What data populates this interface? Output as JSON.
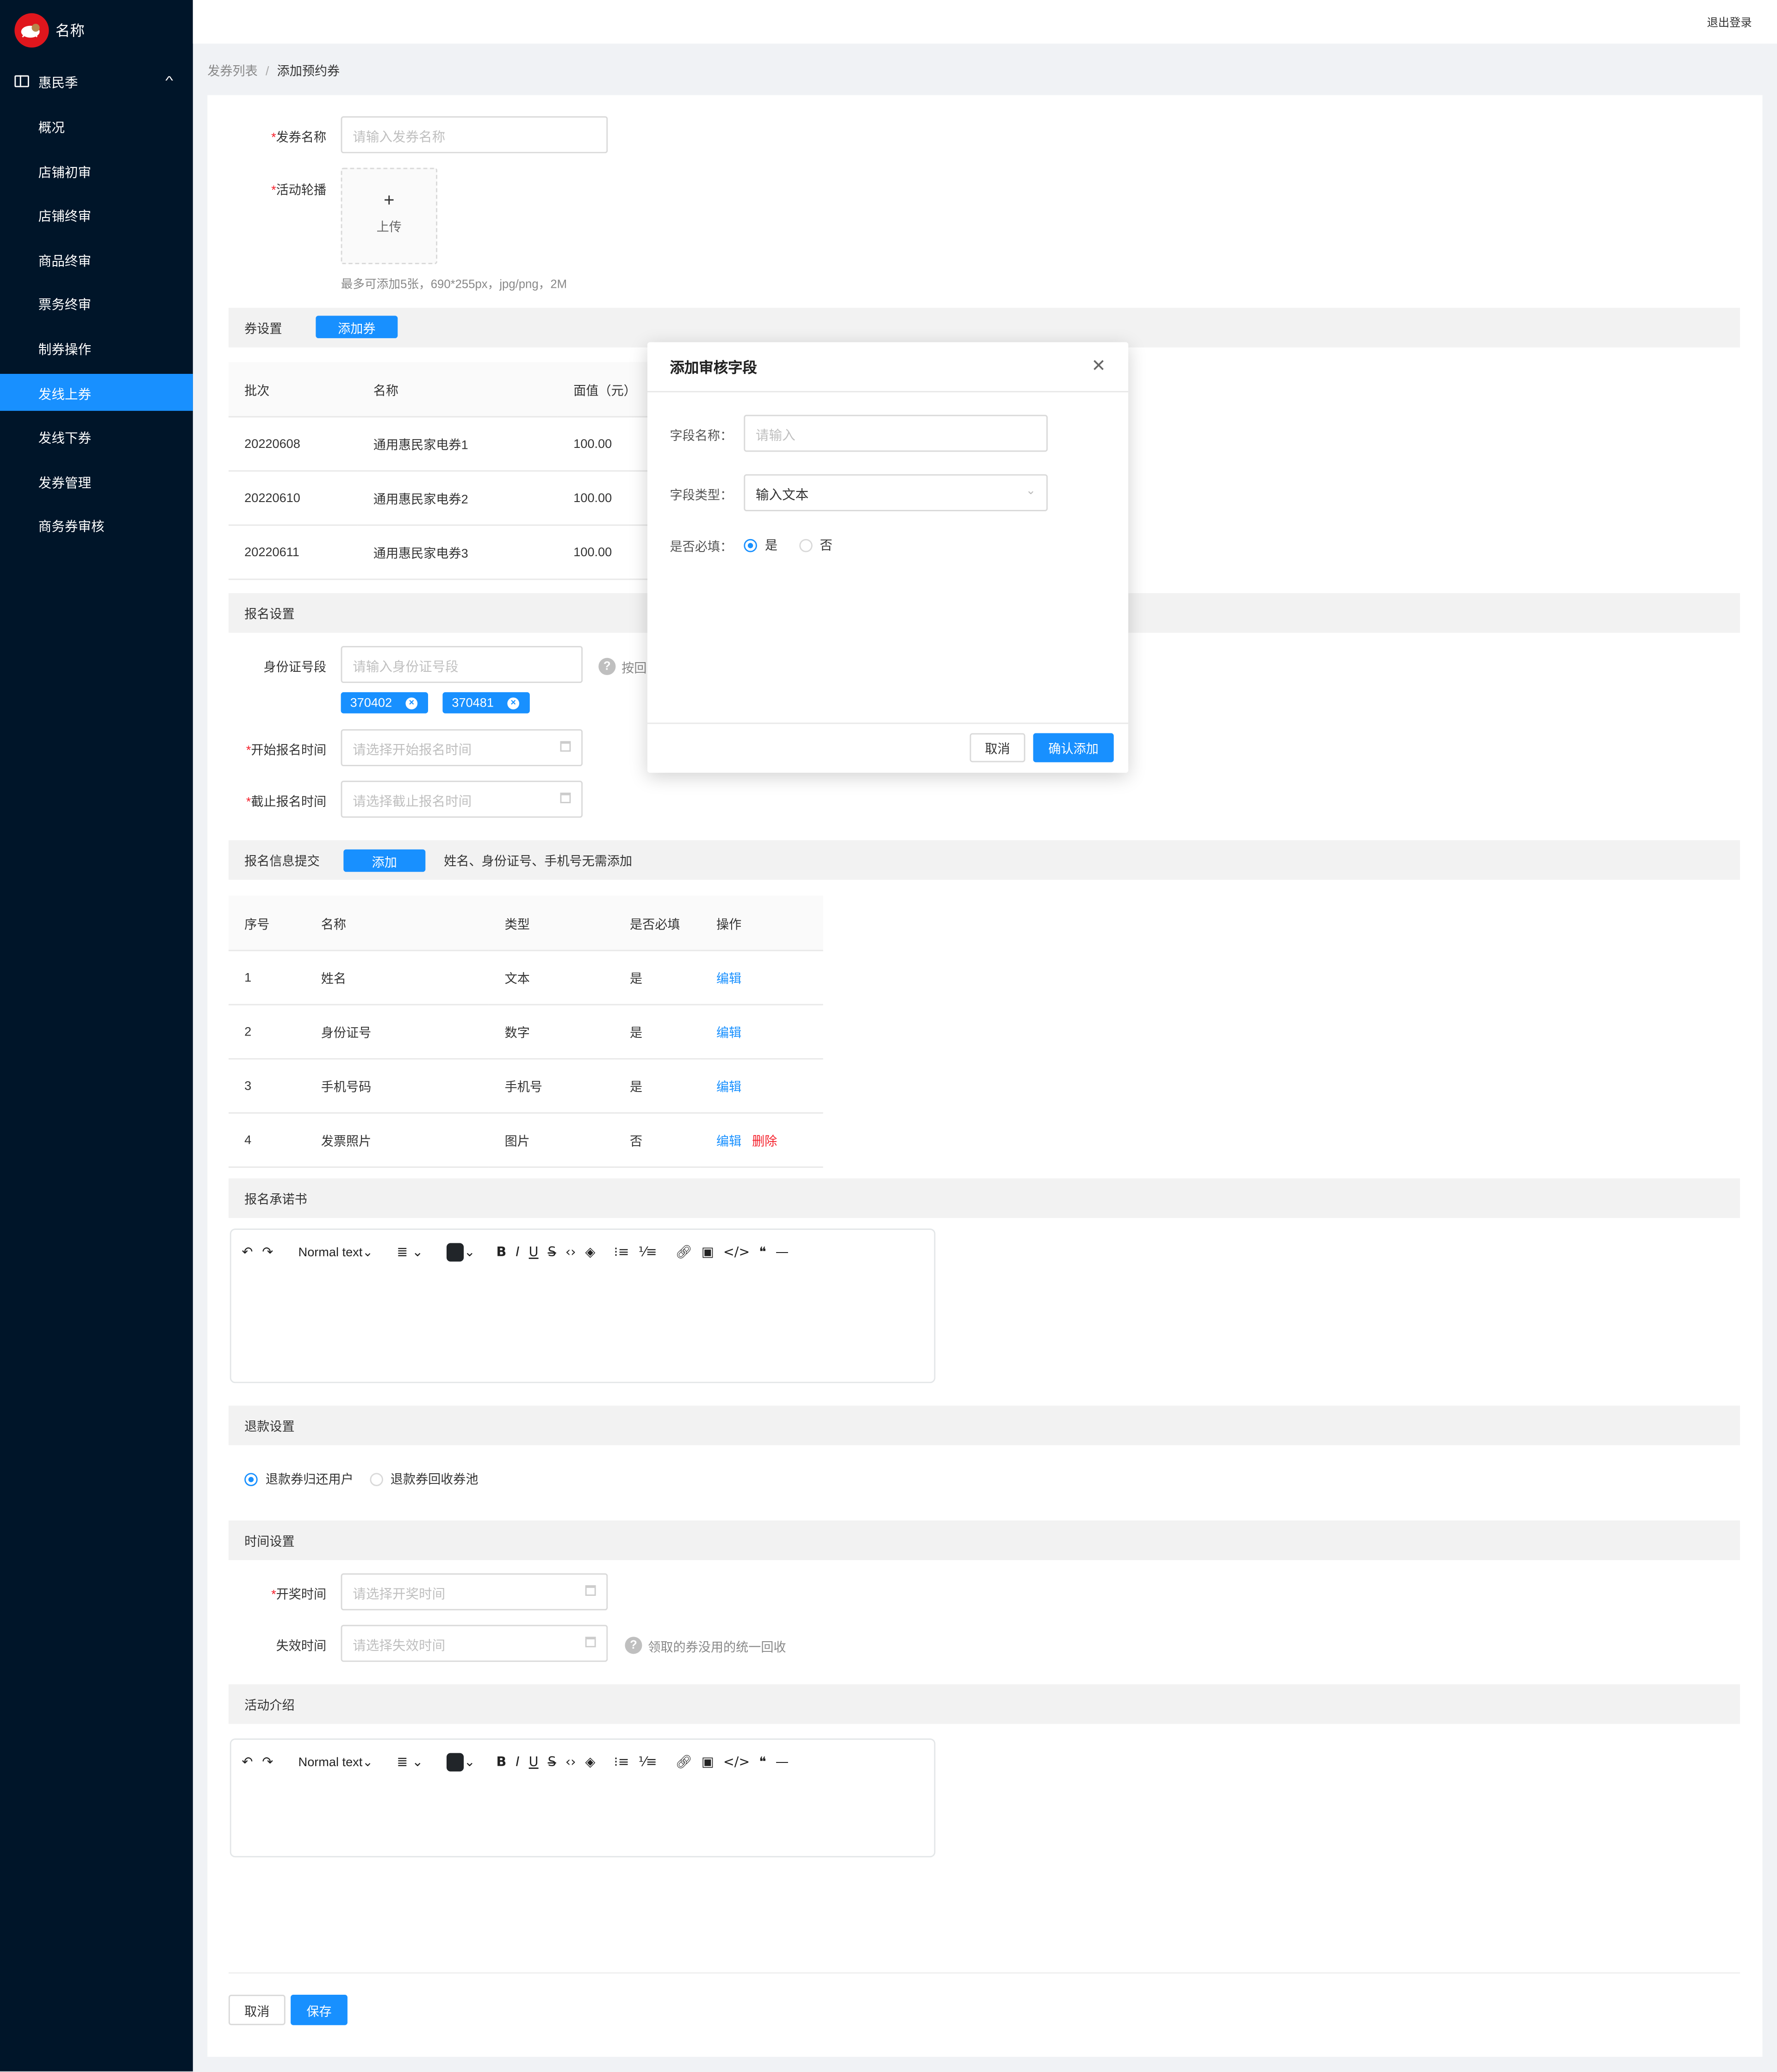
{
  "app": {
    "name": "名称",
    "logout": "退出登录"
  },
  "sidebar": {
    "group": {
      "label": "惠民季",
      "icon": "ticket-icon",
      "expanded": true
    },
    "items": [
      {
        "label": "概况",
        "active": false
      },
      {
        "label": "店铺初审",
        "active": false
      },
      {
        "label": "店铺终审",
        "active": false
      },
      {
        "label": "商品终审",
        "active": false
      },
      {
        "label": "票务终审",
        "active": false
      },
      {
        "label": "制券操作",
        "active": false
      },
      {
        "label": "发线上券",
        "active": true
      },
      {
        "label": "发线下券",
        "active": false
      },
      {
        "label": "发券管理",
        "active": false
      },
      {
        "label": "商务券审核",
        "active": false
      }
    ]
  },
  "breadcrumb": {
    "parent": "发券列表",
    "separator": "/",
    "current": "添加预约券"
  },
  "form": {
    "coupon_name": {
      "label": "发券名称",
      "required": true,
      "placeholder": "请输入发券名称",
      "value": ""
    },
    "carousel": {
      "label": "活动轮播",
      "required": true,
      "upload_label": "上传",
      "upload_icon": "+",
      "hint": "最多可添加5张，690*255px，jpg/png，2M"
    }
  },
  "coupon_settings": {
    "title": "券设置",
    "add_button": "添加券",
    "columns": [
      "批次",
      "名称",
      "面值（元）"
    ],
    "rows": [
      [
        "20220608",
        "通用惠民家电券1",
        "100.00"
      ],
      [
        "20220610",
        "通用惠民家电券2",
        "100.00"
      ],
      [
        "20220611",
        "通用惠民家电券3",
        "100.00"
      ]
    ]
  },
  "registration": {
    "title": "报名设置",
    "id_prefix": {
      "label": "身份证号段",
      "placeholder": "请输入身份证号段",
      "hint": "按回",
      "tags": [
        "370402",
        "370481"
      ]
    },
    "start_time": {
      "label": "开始报名时间",
      "required": true,
      "placeholder": "请选择开始报名时间"
    },
    "end_time": {
      "label": "截止报名时间",
      "required": true,
      "placeholder": "请选择截止报名时间"
    }
  },
  "info_submit": {
    "title": "报名信息提交",
    "add_button": "添加",
    "note": "姓名、身份证号、手机号无需添加",
    "columns": [
      "序号",
      "名称",
      "类型",
      "是否必填",
      "操作"
    ],
    "rows": [
      {
        "no": "1",
        "name": "姓名",
        "type": "文本",
        "required": "是",
        "actions": [
          "编辑"
        ]
      },
      {
        "no": "2",
        "name": "身份证号",
        "type": "数字",
        "required": "是",
        "actions": [
          "编辑"
        ]
      },
      {
        "no": "3",
        "name": "手机号码",
        "type": "手机号",
        "required": "是",
        "actions": [
          "编辑"
        ]
      },
      {
        "no": "4",
        "name": "发票照片",
        "type": "图片",
        "required": "否",
        "actions": [
          "编辑",
          "删除"
        ]
      }
    ]
  },
  "pledge": {
    "title": "报名承诺书"
  },
  "editor_toolbar": {
    "block_type": "Normal text",
    "text_color": "#212529",
    "tools": [
      "undo-icon",
      "redo-icon",
      "align-icon",
      "bold-icon",
      "italic-icon",
      "underline-icon",
      "strikethrough-icon",
      "inline-code-icon",
      "clear-format-icon",
      "bullet-list-icon",
      "ordered-list-icon",
      "link-icon",
      "image-icon",
      "code-block-icon",
      "blockquote-icon",
      "divider-icon"
    ]
  },
  "refund": {
    "title": "退款设置",
    "options": [
      {
        "label": "退款券归还用户",
        "selected": true
      },
      {
        "label": "退款券回收券池",
        "selected": false
      }
    ]
  },
  "time_settings": {
    "title": "时间设置",
    "draw_time": {
      "label": "开奖时间",
      "required": true,
      "placeholder": "请选择开奖时间"
    },
    "expire_time": {
      "label": "失效时间",
      "required": false,
      "placeholder": "请选择失效时间",
      "hint": "领取的券没用的统一回收"
    }
  },
  "intro": {
    "title": "活动介绍"
  },
  "footer": {
    "cancel": "取消",
    "save": "保存"
  },
  "modal": {
    "title": "添加审核字段",
    "field_name": {
      "label": "字段名称：",
      "placeholder": "请输入",
      "value": ""
    },
    "field_type": {
      "label": "字段类型：",
      "value": "输入文本"
    },
    "required": {
      "label": "是否必填：",
      "options": [
        {
          "label": "是",
          "selected": true
        },
        {
          "label": "否",
          "selected": false
        }
      ]
    },
    "cancel": "取消",
    "confirm": "确认添加"
  },
  "colors": {
    "primary": "#1890ff",
    "sidebar": "#001529",
    "danger": "#f5222d"
  }
}
